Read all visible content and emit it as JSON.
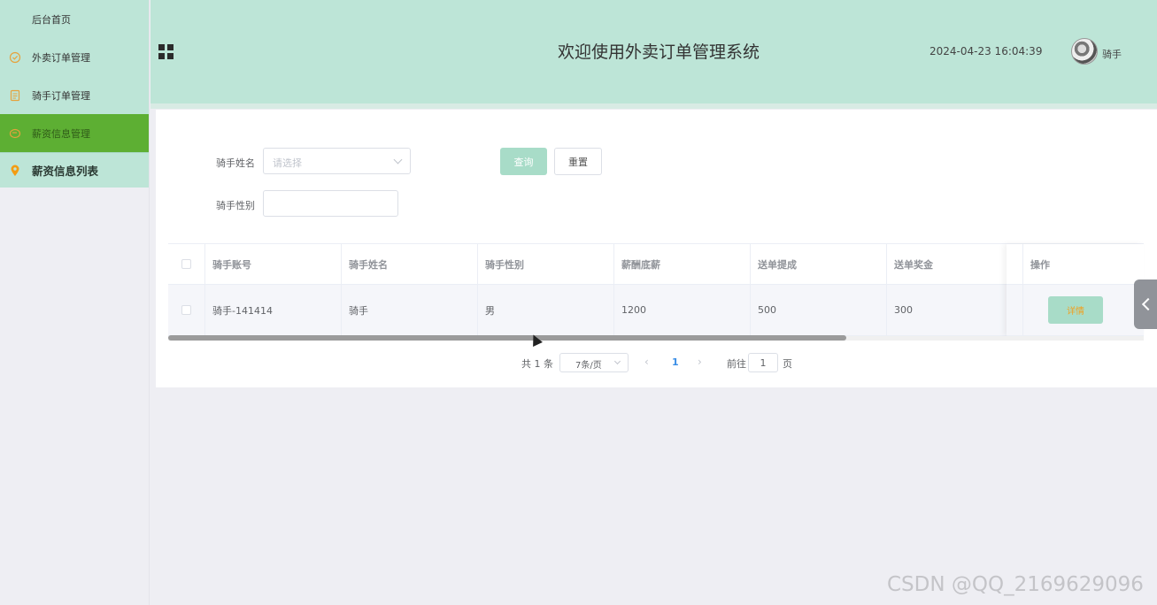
{
  "sidebar": {
    "home": "后台首页",
    "items": [
      {
        "label": "外卖订单管理",
        "icon": "check-circle-icon"
      },
      {
        "label": "骑手订单管理",
        "icon": "document-icon"
      },
      {
        "label": "薪资信息管理",
        "icon": "wallet-icon"
      }
    ],
    "sub_item": {
      "label": "薪资信息列表",
      "icon": "location-pin-icon"
    }
  },
  "header": {
    "title": "欢迎使用外卖订单管理系统",
    "datetime": "2024-04-23 16:04:39",
    "username": "骑手"
  },
  "filters": {
    "rider_name_label": "骑手姓名",
    "rider_name_placeholder": "请选择",
    "rider_gender_label": "骑手性别",
    "query_button": "查询",
    "reset_button": "重置"
  },
  "table": {
    "columns": [
      "骑手账号",
      "骑手姓名",
      "骑手性别",
      "薪酬底薪",
      "送单提成",
      "送单奖金",
      "操作"
    ],
    "rows": [
      {
        "account": "骑手-141414",
        "name": "骑手",
        "gender": "男",
        "base_salary": "1200",
        "commission": "500",
        "bonus": "300",
        "action": "详情"
      }
    ]
  },
  "pagination": {
    "total": "共 1 条",
    "page_size": "7条/页",
    "current_page": "1",
    "goto_label": "前往",
    "goto_value": "1",
    "page_suffix": "页"
  },
  "watermark": "CSDN @QQ_2169629096",
  "colors": {
    "accent": "#bde5d7",
    "active": "#5daf33",
    "button": "#a8dcc8"
  }
}
